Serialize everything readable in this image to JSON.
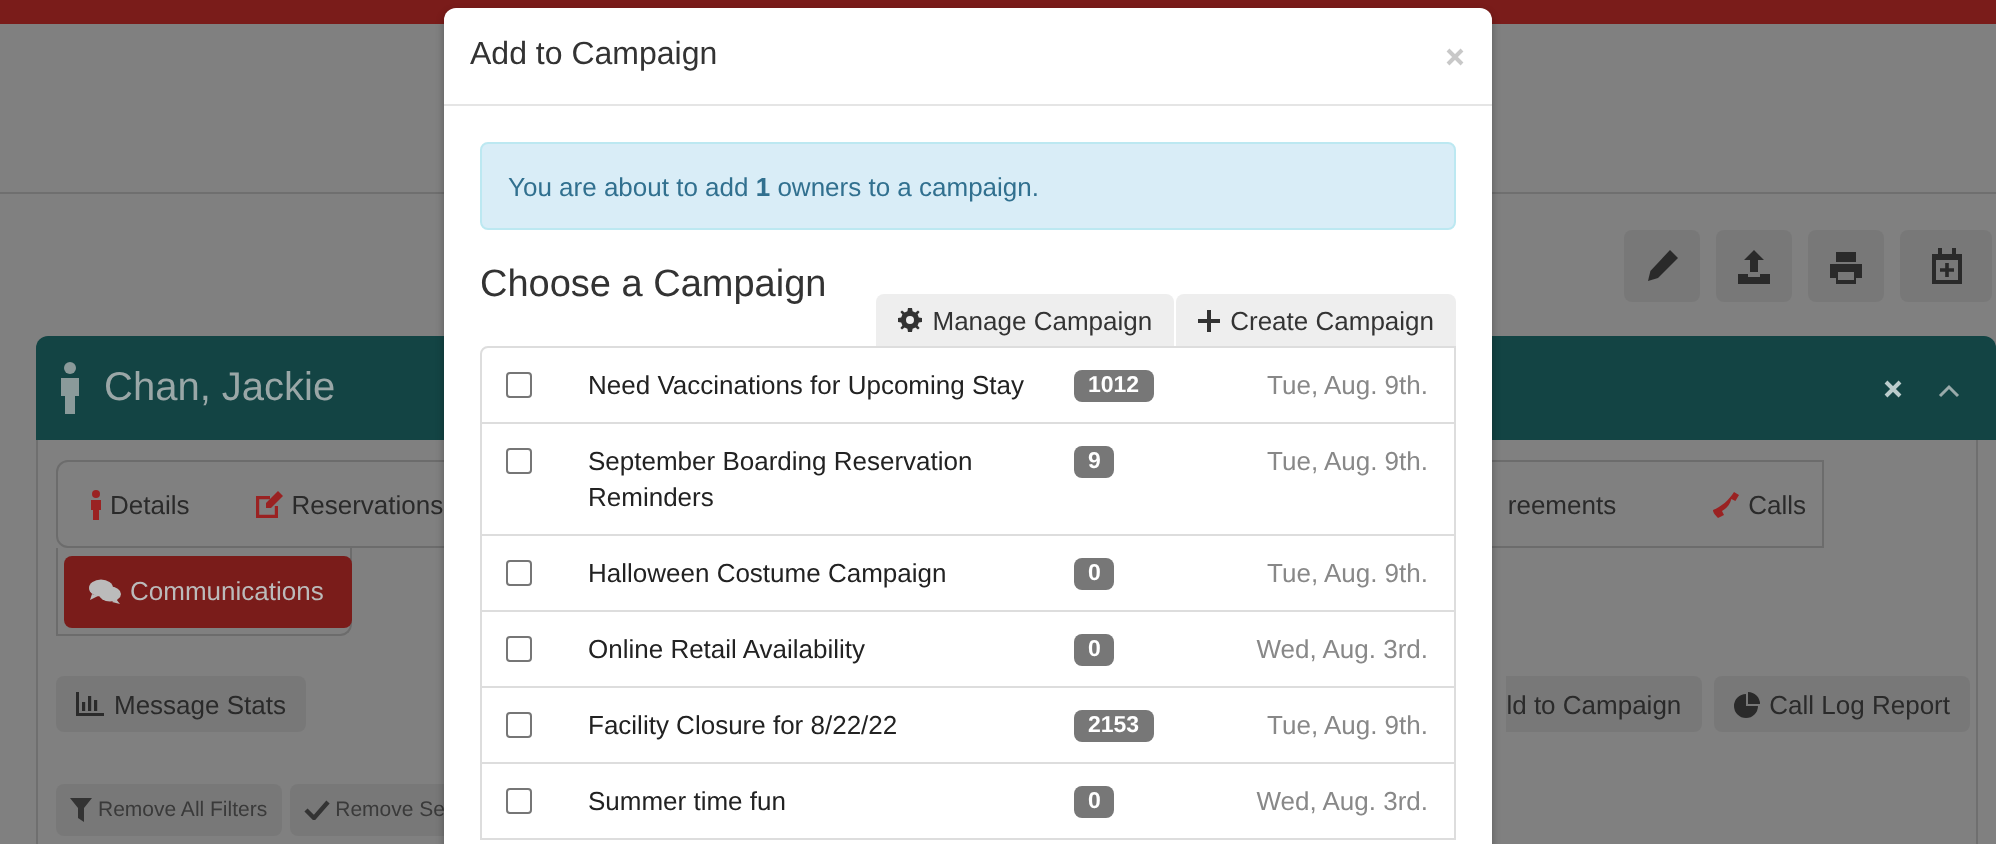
{
  "profile": {
    "name": "Chan, Jackie"
  },
  "tabs": [
    {
      "label": "Details",
      "selected": false,
      "kind": "person"
    },
    {
      "label": "Reservations",
      "selected": false,
      "kind": "edit"
    },
    {
      "label": "reements",
      "selected": false,
      "kind": "plain"
    },
    {
      "label": "Calls",
      "selected": false,
      "kind": "phone"
    },
    {
      "label": "Communications",
      "selected": true,
      "kind": "comments"
    }
  ],
  "actions": {
    "left": [
      "Message Stats"
    ],
    "right": [
      "ld to Campaign",
      "Call Log Report"
    ]
  },
  "filters": [
    "Remove All Filters",
    "Remove Se"
  ],
  "dialog": {
    "title": "Add to Campaign",
    "alert": "You are about to add **1** owners to a campaign.",
    "heading": "Choose a Campaign",
    "buttons": [
      "Manage Campaign",
      "Create Campaign"
    ],
    "campaigns": [
      {
        "name": "Need Vaccinations for Upcoming Stay",
        "count": "1012",
        "date": "Tue, Aug. 9th.",
        "checked": false
      },
      {
        "name": "September Boarding Reservation Reminders",
        "count": "9",
        "date": "Tue, Aug. 9th.",
        "checked": false
      },
      {
        "name": "Halloween Costume Campaign",
        "count": "0",
        "date": "Tue, Aug. 9th.",
        "checked": false
      },
      {
        "name": "Online Retail Availability",
        "count": "0",
        "date": "Wed, Aug. 3rd.",
        "checked": false
      },
      {
        "name": "Facility Closure for 8/22/22",
        "count": "2153",
        "date": "Tue, Aug. 9th.",
        "checked": false
      },
      {
        "name": "Summer time fun",
        "count": "0",
        "date": "Wed, Aug. 3rd.",
        "checked": false
      }
    ]
  }
}
